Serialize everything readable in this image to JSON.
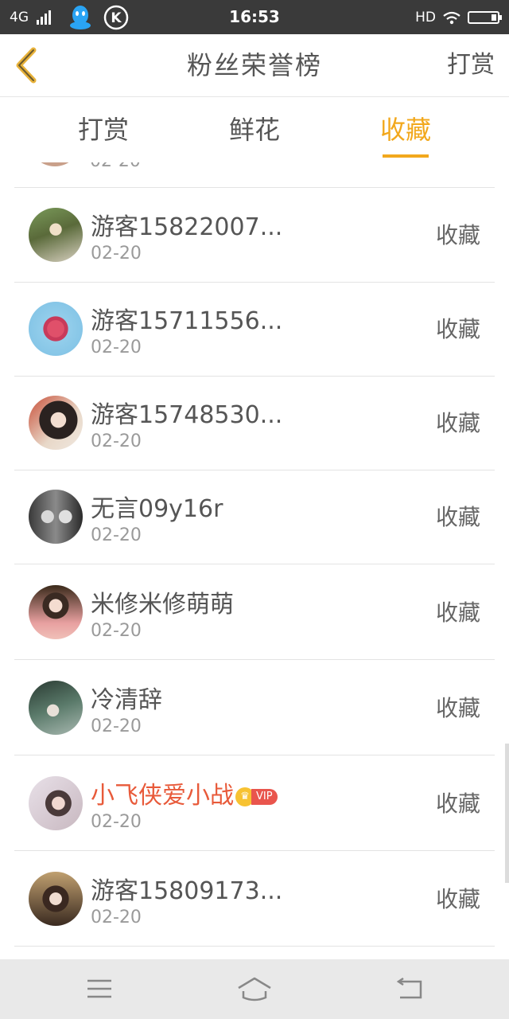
{
  "status_bar": {
    "network": "4G",
    "time": "16:53",
    "hd": "HD",
    "app_icons": [
      "qq-icon",
      "k-icon"
    ]
  },
  "header": {
    "title": "粉丝荣誉榜",
    "right_label": "打赏"
  },
  "tabs": [
    {
      "label": "打赏",
      "active": false
    },
    {
      "label": "鲜花",
      "active": false
    },
    {
      "label": "收藏",
      "active": true
    }
  ],
  "list": {
    "partial_date": "02-20",
    "items": [
      {
        "name": "游客15822007...",
        "date": "02-20",
        "action": "收藏",
        "vip": false
      },
      {
        "name": "游客15711556...",
        "date": "02-20",
        "action": "收藏",
        "vip": false
      },
      {
        "name": "游客15748530...",
        "date": "02-20",
        "action": "收藏",
        "vip": false
      },
      {
        "name": "无言09y16r",
        "date": "02-20",
        "action": "收藏",
        "vip": false
      },
      {
        "name": "米修米修萌萌",
        "date": "02-20",
        "action": "收藏",
        "vip": false
      },
      {
        "name": "冷清辞",
        "date": "02-20",
        "action": "收藏",
        "vip": false
      },
      {
        "name": "小飞侠爱小战",
        "date": "02-20",
        "action": "收藏",
        "vip": true,
        "badge": "VIP"
      },
      {
        "name": "游客15809173...",
        "date": "02-20",
        "action": "收藏",
        "vip": false
      }
    ]
  },
  "colors": {
    "accent": "#f2a81d",
    "vip_name": "#e85a3a",
    "status_bar": "#3a3a3a"
  }
}
